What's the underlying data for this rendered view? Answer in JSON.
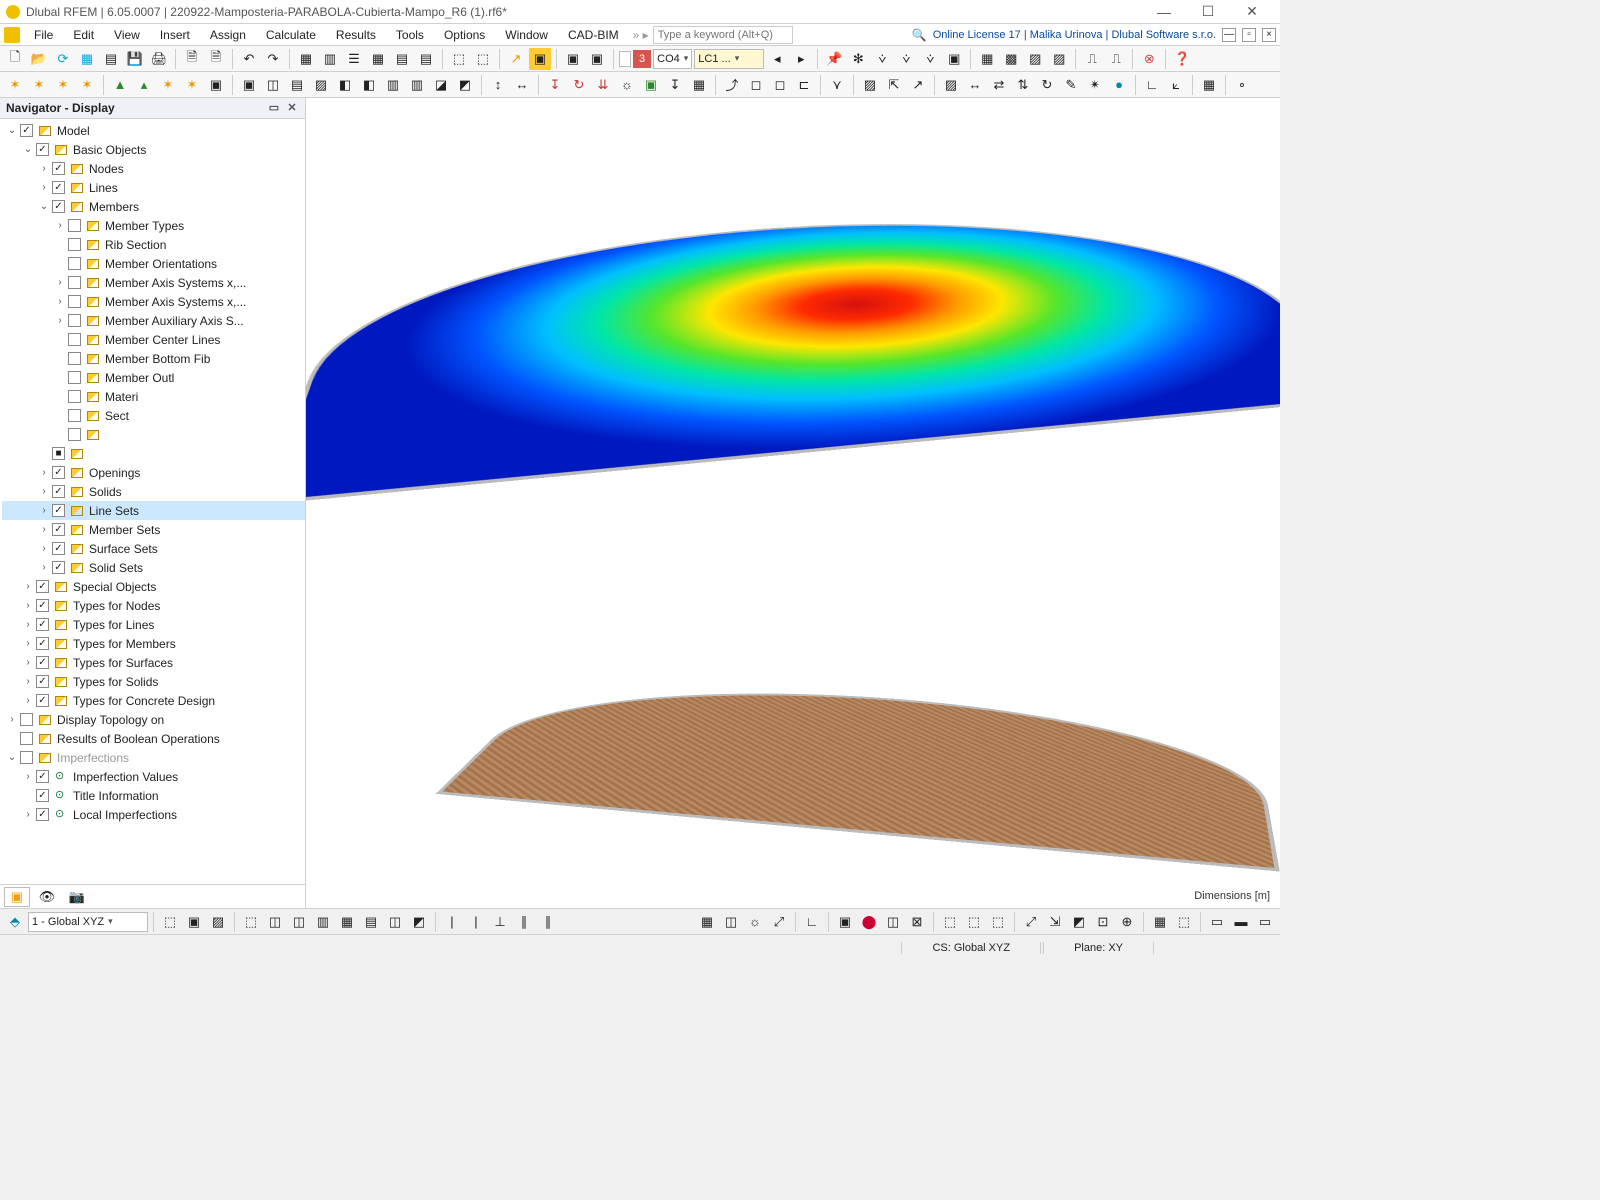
{
  "title_bar": {
    "text": "Dlubal RFEM | 6.05.0007 | 220922-Mamposteria-PARABOLA-Cubierta-Mampo_R6 (1).rf6*"
  },
  "menus": [
    "File",
    "Edit",
    "View",
    "Insert",
    "Assign",
    "Calculate",
    "Results",
    "Tools",
    "Options",
    "Window",
    "CAD-BIM"
  ],
  "search": {
    "placeholder": "Type a keyword (Alt+Q)"
  },
  "license": "Online License 17 | Malika Urinova | Dlubal Software s.r.o.",
  "toolbar1": {
    "badge_num": "3",
    "combo_co": "CO4",
    "combo_lc": "LC1 ..."
  },
  "navigator": {
    "title": "Navigator - Display",
    "tree": [
      {
        "depth": 0,
        "exp": "v",
        "check": "v",
        "cls": "pencil",
        "label": "Model"
      },
      {
        "depth": 1,
        "exp": "v",
        "check": "v",
        "cls": "pencil",
        "label": "Basic Objects"
      },
      {
        "depth": 2,
        "exp": ">",
        "check": "v",
        "cls": "pencil",
        "label": "Nodes"
      },
      {
        "depth": 2,
        "exp": ">",
        "check": "v",
        "cls": "pencil",
        "label": "Lines"
      },
      {
        "depth": 2,
        "exp": "v",
        "check": "v",
        "cls": "pencil",
        "label": "Members"
      },
      {
        "depth": 3,
        "exp": ">",
        "check": " ",
        "cls": "pencil",
        "label": "Member Types"
      },
      {
        "depth": 3,
        "exp": " ",
        "check": " ",
        "cls": "pencil",
        "label": "Rib Section"
      },
      {
        "depth": 3,
        "exp": " ",
        "check": " ",
        "cls": "pencil",
        "label": "Member Orientations"
      },
      {
        "depth": 3,
        "exp": ">",
        "check": " ",
        "cls": "pencil",
        "label": "Member Axis Systems x,..."
      },
      {
        "depth": 3,
        "exp": ">",
        "check": " ",
        "cls": "pencil",
        "label": "Member Axis Systems x,..."
      },
      {
        "depth": 3,
        "exp": ">",
        "check": " ",
        "cls": "pencil",
        "label": "Member Auxiliary Axis S..."
      },
      {
        "depth": 3,
        "exp": " ",
        "check": " ",
        "cls": "pencil",
        "label": "Member Center Lines"
      },
      {
        "depth": 3,
        "exp": " ",
        "check": " ",
        "cls": "pencil",
        "label": "Member Bottom Fib"
      },
      {
        "depth": 3,
        "exp": " ",
        "check": " ",
        "cls": "pencil",
        "label": "Member Outl"
      },
      {
        "depth": 3,
        "exp": " ",
        "check": " ",
        "cls": "pencil",
        "label": "Materi"
      },
      {
        "depth": 3,
        "exp": " ",
        "check": " ",
        "cls": "pencil",
        "label": "Sect"
      },
      {
        "depth": 3,
        "exp": " ",
        "check": " ",
        "cls": "pencil",
        "label": ""
      },
      {
        "depth": 2,
        "exp": " ",
        "check": "-",
        "cls": "pencil",
        "label": ""
      },
      {
        "depth": 2,
        "exp": ">",
        "check": "v",
        "cls": "pencil",
        "label": "Openings"
      },
      {
        "depth": 2,
        "exp": ">",
        "check": "v",
        "cls": "pencil",
        "label": "Solids"
      },
      {
        "depth": 2,
        "exp": ">",
        "check": "v",
        "cls": "pencil",
        "label": "Line Sets",
        "selected": true
      },
      {
        "depth": 2,
        "exp": ">",
        "check": "v",
        "cls": "pencil",
        "label": "Member Sets"
      },
      {
        "depth": 2,
        "exp": ">",
        "check": "v",
        "cls": "pencil",
        "label": "Surface Sets"
      },
      {
        "depth": 2,
        "exp": ">",
        "check": "v",
        "cls": "pencil",
        "label": "Solid Sets"
      },
      {
        "depth": 1,
        "exp": ">",
        "check": "v",
        "cls": "pencil",
        "label": "Special Objects"
      },
      {
        "depth": 1,
        "exp": ">",
        "check": "v",
        "cls": "pencil",
        "label": "Types for Nodes"
      },
      {
        "depth": 1,
        "exp": ">",
        "check": "v",
        "cls": "pencil",
        "label": "Types for Lines"
      },
      {
        "depth": 1,
        "exp": ">",
        "check": "v",
        "cls": "pencil",
        "label": "Types for Members"
      },
      {
        "depth": 1,
        "exp": ">",
        "check": "v",
        "cls": "pencil",
        "label": "Types for Surfaces"
      },
      {
        "depth": 1,
        "exp": ">",
        "check": "v",
        "cls": "pencil",
        "label": "Types for Solids"
      },
      {
        "depth": 1,
        "exp": ">",
        "check": "v",
        "cls": "pencil",
        "label": "Types for Concrete Design"
      },
      {
        "depth": 0,
        "exp": ">",
        "check": " ",
        "cls": "pencil",
        "label": "Display Topology on"
      },
      {
        "depth": 0,
        "exp": " ",
        "check": " ",
        "cls": "pencil",
        "label": "Results of Boolean Operations"
      },
      {
        "depth": 0,
        "exp": "v",
        "check": " ",
        "cls": "pencil",
        "label": "Imperfections",
        "dim": true
      },
      {
        "depth": 1,
        "exp": ">",
        "check": "v",
        "cls": "imp",
        "label": "Imperfection Values"
      },
      {
        "depth": 1,
        "exp": " ",
        "check": "v",
        "cls": "imp",
        "label": "Title Information"
      },
      {
        "depth": 1,
        "exp": ">",
        "check": "v",
        "cls": "imp",
        "label": "Local Imperfections"
      }
    ]
  },
  "viewport": {
    "dimensions_label": "Dimensions [m]"
  },
  "bottom_bar": {
    "cs_combo": "1 - Global XYZ"
  },
  "status_bar": {
    "cs": "CS: Global XYZ",
    "plane": "Plane: XY"
  }
}
